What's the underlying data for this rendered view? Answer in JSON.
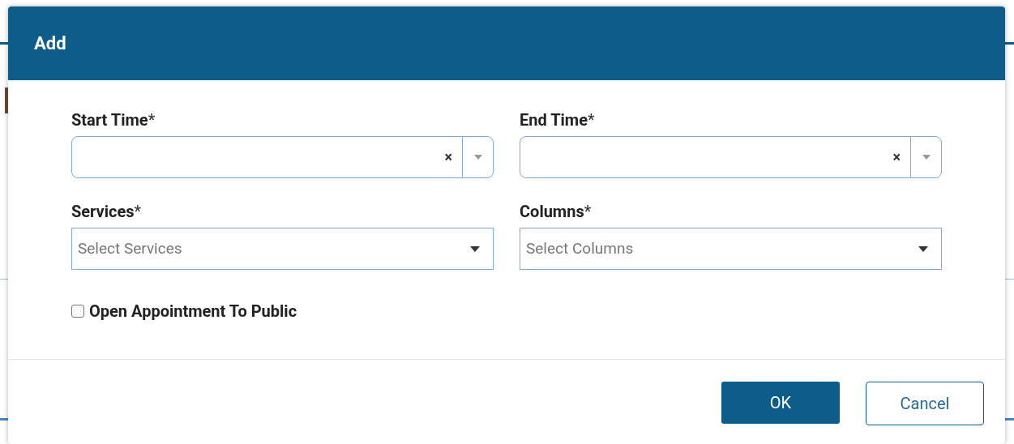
{
  "dialog": {
    "title": "Add"
  },
  "fields": [
    {
      "kind": "time",
      "label": "Start Time",
      "required": true,
      "required_mark": "*",
      "clear": "×"
    },
    {
      "kind": "time",
      "label": "End Time",
      "required": true,
      "required_mark": "*",
      "clear": "×"
    },
    {
      "kind": "select",
      "label": "Services",
      "required": true,
      "required_mark": "*",
      "placeholder": "Select Services"
    },
    {
      "kind": "select",
      "label": "Columns",
      "required": true,
      "required_mark": "*",
      "placeholder": "Select Columns"
    }
  ],
  "checkbox": {
    "label": "Open Appointment To Public",
    "checked": false
  },
  "buttons": [
    {
      "kind": "primary",
      "label": "OK"
    },
    {
      "kind": "secondary",
      "label": "Cancel"
    }
  ]
}
